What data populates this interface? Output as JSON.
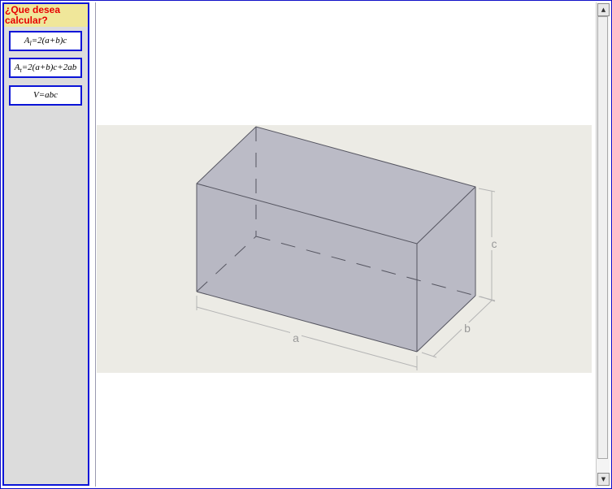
{
  "sidebar": {
    "title": "¿Que desea calcular?",
    "buttons": [
      {
        "label": "A",
        "sub": "l",
        "rest": "=2(a+b)c"
      },
      {
        "label": "A",
        "sub": "t",
        "rest": "=2(a+b)c+2ab"
      },
      {
        "label": "V=abc",
        "sub": "",
        "rest": ""
      }
    ]
  },
  "figure": {
    "labels": {
      "a": "a",
      "b": "b",
      "c": "c"
    },
    "colors": {
      "background": "#ecebe5",
      "face": "#b8b8c4",
      "edge": "#555560",
      "dimension": "#b0b0b0"
    }
  },
  "scrollbar": {
    "up_icon": "▲",
    "down_icon": "▼"
  }
}
